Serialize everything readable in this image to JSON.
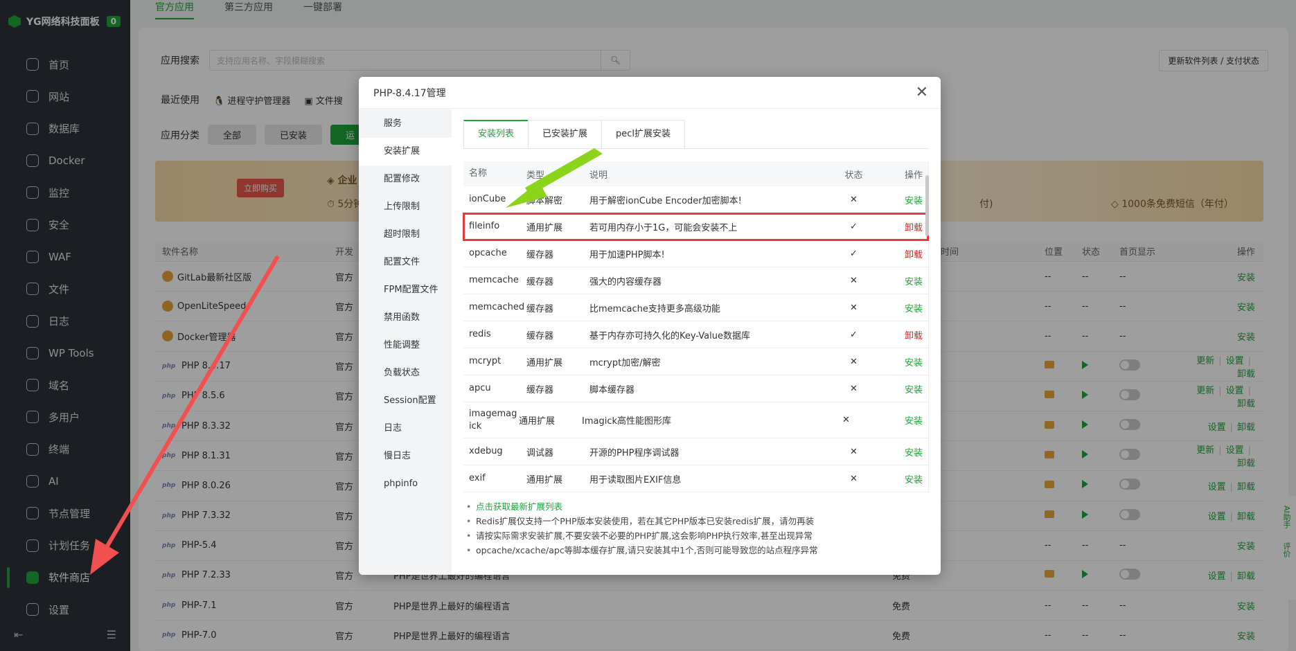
{
  "sidebar": {
    "brand": "YG网络科技面板",
    "badge": "0",
    "items": [
      {
        "label": "首页"
      },
      {
        "label": "网站"
      },
      {
        "label": "数据库"
      },
      {
        "label": "Docker"
      },
      {
        "label": "监控"
      },
      {
        "label": "安全"
      },
      {
        "label": "WAF"
      },
      {
        "label": "文件"
      },
      {
        "label": "日志"
      },
      {
        "label": "WP Tools"
      },
      {
        "label": "域名"
      },
      {
        "label": "多用户"
      },
      {
        "label": "终端"
      },
      {
        "label": "AI"
      },
      {
        "label": "节点管理"
      },
      {
        "label": "计划任务"
      },
      {
        "label": "软件商店"
      },
      {
        "label": "设置"
      }
    ]
  },
  "topbar": {
    "tabs": [
      "官方应用",
      "第三方应用",
      "一键部署"
    ]
  },
  "search": {
    "label": "应用搜索",
    "placeholder": "支持应用名称、字段模糊搜索"
  },
  "refresh_button": "更新软件列表 / 支付状态",
  "recent": {
    "label": "最近使用",
    "items": [
      "进程守护管理器",
      "文件搜"
    ]
  },
  "category": {
    "label": "应用分类",
    "chips": [
      "全部",
      "已安装",
      "运"
    ]
  },
  "promo": {
    "buy": "立即购买",
    "title": "企业",
    "sub1": "5分钟",
    "sub2": "付)",
    "sub3": "1000条免费短信（年付）"
  },
  "bg_table": {
    "headers": {
      "name": "软件名称",
      "dev": "开发",
      "expire": "时间",
      "pos": "位置",
      "status": "状态",
      "home": "首页显示",
      "op": "操作"
    },
    "rows": [
      {
        "name": "GitLab最新社区版",
        "dev": "官方",
        "desc": "",
        "price": "",
        "pos": "--",
        "st": "--",
        "home": "--",
        "ops": [
          "安装"
        ]
      },
      {
        "name": "OpenLiteSpeed",
        "dev": "官方",
        "desc": "",
        "price": "",
        "pos": "--",
        "st": "--",
        "home": "--",
        "ops": [
          "安装"
        ]
      },
      {
        "name": "Docker管理器",
        "dev": "官方",
        "desc": "",
        "price": "",
        "pos": "--",
        "st": "--",
        "home": "--",
        "ops": [
          "安装"
        ]
      },
      {
        "name": "PHP 8.4.17",
        "dev": "官方",
        "desc": "",
        "price": "",
        "ops": [
          "更新",
          "设置",
          "卸载"
        ],
        "installed": true
      },
      {
        "name": "PHP 8.5.6",
        "dev": "官方",
        "desc": "",
        "price": "",
        "ops": [
          "更新",
          "设置",
          "卸载"
        ],
        "installed": true
      },
      {
        "name": "PHP 8.3.32",
        "dev": "官方",
        "desc": "",
        "price": "",
        "ops": [
          "设置",
          "卸载"
        ],
        "installed": true
      },
      {
        "name": "PHP 8.1.31",
        "dev": "官方",
        "desc": "",
        "price": "",
        "ops": [
          "更新",
          "设置",
          "卸载"
        ],
        "installed": true
      },
      {
        "name": "PHP 8.0.26",
        "dev": "官方",
        "desc": "",
        "price": "",
        "ops": [
          "设置",
          "卸载"
        ],
        "installed": true
      },
      {
        "name": "PHP 7.3.32",
        "dev": "官方",
        "desc": "",
        "price": "",
        "ops": [
          "设置",
          "卸载"
        ],
        "installed": true
      },
      {
        "name": "PHP-5.4",
        "dev": "官方",
        "desc": "",
        "price": "",
        "pos": "--",
        "st": "--",
        "home": "--",
        "ops": [
          "安装"
        ]
      },
      {
        "name": "PHP 7.2.33",
        "dev": "官方",
        "desc": "PHP是世界上最好的编程语言",
        "price": "免费",
        "ops": [
          "设置",
          "卸载"
        ],
        "installed": true
      },
      {
        "name": "PHP-7.1",
        "dev": "官方",
        "desc": "PHP是世界上最好的编程语言",
        "price": "免费",
        "pos": "--",
        "st": "--",
        "home": "--",
        "ops": [
          "安装"
        ]
      },
      {
        "name": "PHP-7.0",
        "dev": "官方",
        "desc": "PHP是世界上最好的编程语言",
        "price": "免费",
        "pos": "--",
        "st": "--",
        "home": "--",
        "ops": [
          "安装"
        ]
      }
    ]
  },
  "right_tools": [
    "AI助手",
    "评价"
  ],
  "modal": {
    "title": "PHP-8.4.17管理",
    "nav": [
      "服务",
      "安装扩展",
      "配置修改",
      "上传限制",
      "超时限制",
      "配置文件",
      "FPM配置文件",
      "禁用函数",
      "性能调整",
      "负载状态",
      "Session配置",
      "日志",
      "慢日志",
      "phpinfo"
    ],
    "tabs": [
      "安装列表",
      "已安装扩展",
      "pecl扩展安装"
    ],
    "table_headers": {
      "name": "名称",
      "type": "类型",
      "desc": "说明",
      "state": "状态",
      "op": "操作"
    },
    "extensions": [
      {
        "name": "ionCube",
        "type": "脚本解密",
        "desc": "用于解密ionCube Encoder加密脚本!",
        "state": "✕",
        "op": "安装"
      },
      {
        "name": "fileinfo",
        "type": "通用扩展",
        "desc": "若可用内存小于1G，可能会安装不上",
        "state": "✓",
        "op": "卸载"
      },
      {
        "name": "opcache",
        "type": "缓存器",
        "desc": "用于加速PHP脚本!",
        "state": "✓",
        "op": "卸载"
      },
      {
        "name": "memcache",
        "type": "缓存器",
        "desc": "强大的内容缓存器",
        "state": "✕",
        "op": "安装"
      },
      {
        "name": "memcached",
        "type": "缓存器",
        "desc": "比memcache支持更多高级功能",
        "state": "✕",
        "op": "安装"
      },
      {
        "name": "redis",
        "type": "缓存器",
        "desc": "基于内存亦可持久化的Key-Value数据库",
        "state": "✓",
        "op": "卸载"
      },
      {
        "name": "mcrypt",
        "type": "通用扩展",
        "desc": "mcrypt加密/解密",
        "state": "✕",
        "op": "安装"
      },
      {
        "name": "apcu",
        "type": "缓存器",
        "desc": "脚本缓存器",
        "state": "✕",
        "op": "安装"
      },
      {
        "name": "imagemagick",
        "type": "通用扩展",
        "desc": "Imagick高性能图形库",
        "state": "✕",
        "op": "安装"
      },
      {
        "name": "xdebug",
        "type": "调试器",
        "desc": "开源的PHP程序调试器",
        "state": "✕",
        "op": "安装"
      },
      {
        "name": "exif",
        "type": "通用扩展",
        "desc": "用于读取图片EXIF信息",
        "state": "✕",
        "op": "安装"
      }
    ],
    "notes": [
      "点击获取最新扩展列表",
      "Redis扩展仅支持一个PHP版本安装使用，若在其它PHP版本已安装redis扩展，请勿再装",
      "请按实际需求安装扩展,不要安装不必要的PHP扩展,这会影响PHP执行效率,甚至出现异常",
      "opcache/xcache/apc等脚本缓存扩展,请只安装其中1个,否则可能导致您的站点程序异常"
    ]
  },
  "colors": {
    "brand_green": "#20a53a",
    "danger_red": "#e02020",
    "sidebar_bg": "#2c3138",
    "annotation_red": "#f25050",
    "annotation_green": "#8bd41a"
  }
}
